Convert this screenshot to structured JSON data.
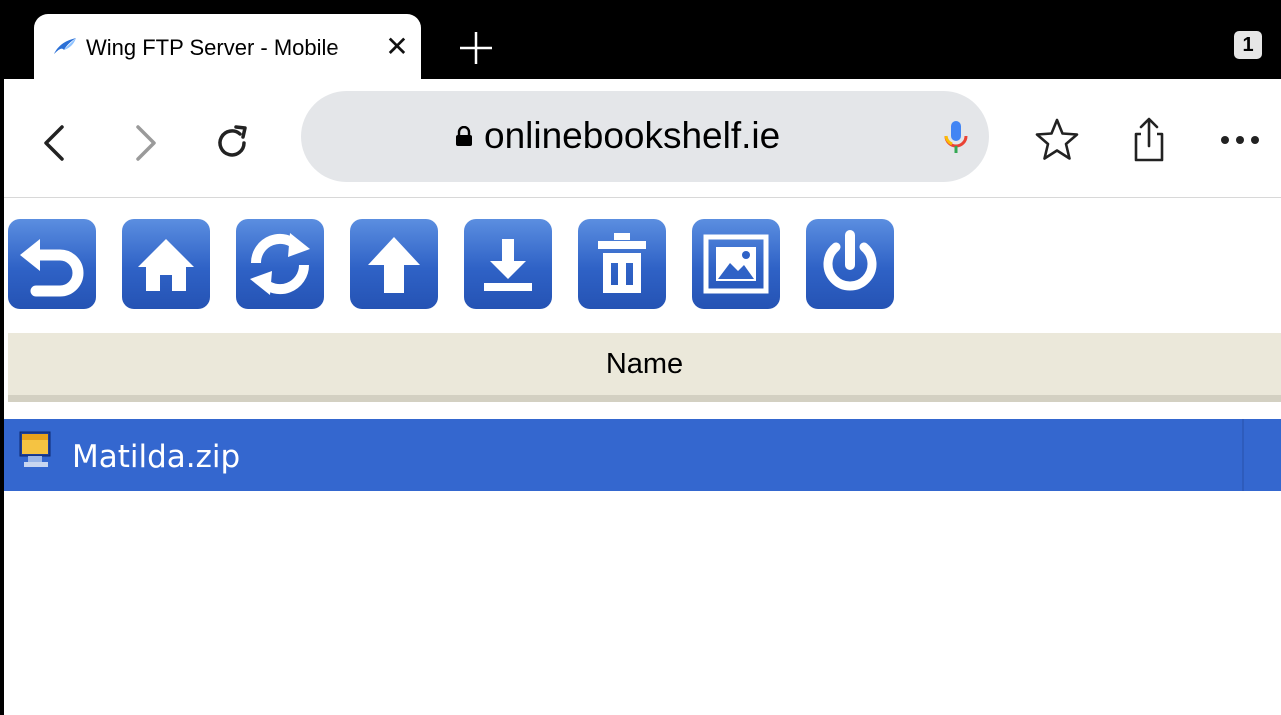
{
  "tab": {
    "title": "Wing FTP Server - Mobile",
    "close_label": "✕",
    "count": "1"
  },
  "address": {
    "url": "onlinebookshelf.ie"
  },
  "ftp_toolbar": {
    "buttons": [
      "back",
      "home",
      "refresh",
      "upload",
      "download",
      "delete",
      "thumbnail",
      "logout"
    ]
  },
  "table": {
    "header": "Name",
    "rows": [
      {
        "name": "Matilda.zip",
        "selected": true
      }
    ]
  },
  "colors": {
    "selection": "#3467cf",
    "header_bg": "#ebe8da",
    "button_blue": "#2f62c6"
  }
}
